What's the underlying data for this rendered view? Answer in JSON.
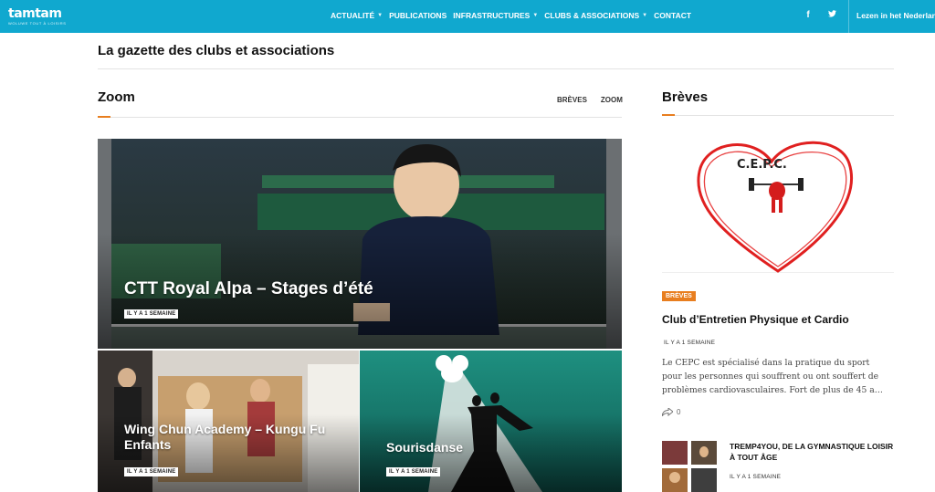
{
  "header": {
    "logo": "tamtam",
    "logo_tagline": "WOLUWE TOUT À LOISIRS",
    "nav": [
      {
        "label": "Actualité",
        "dropdown": true
      },
      {
        "label": "Publications",
        "dropdown": false
      },
      {
        "label": "Infrastructures",
        "dropdown": true
      },
      {
        "label": "Clubs & Associations",
        "dropdown": true
      },
      {
        "label": "Contact",
        "dropdown": false
      }
    ],
    "social": {
      "facebook": "f",
      "twitter": "t"
    },
    "language_link": "Lezen in het Nederlands",
    "bar_color": "#10a8cf"
  },
  "page_title": "La gazette des clubs et associations",
  "zoom_section": {
    "title": "Zoom",
    "tabs": [
      "BRÈVES",
      "ZOOM"
    ],
    "accent_color": "#e87e1f",
    "featured": {
      "title": "CTT Royal Alpa – Stages d’été",
      "time": "IL Y A 1 SEMAINE"
    },
    "cards": [
      {
        "title": "Wing Chun Academy – Kungu Fu Enfants",
        "time": "IL Y A 1 SEMAINE"
      },
      {
        "title": "Sourisdanse",
        "time": "IL Y A 1 SEMAINE"
      }
    ]
  },
  "breves_section": {
    "title": "Brèves",
    "logo_text": "C.E.P.C.",
    "category": "BRÈVES",
    "post_title": "Club d’Entretien Physique et Cardio",
    "time": "IL Y A 1 SEMAINE",
    "excerpt": "Le CEPC est spécialisé dans la pratique du sport pour les personnes qui souffrent ou ont souffert de problèmes cardiovasculaires. Fort de plus de 45 a…",
    "shares": "0",
    "second_post": {
      "title": "TREMP4YOU, de la gymnastique loisir à tout âge",
      "time": "IL Y A 1 SEMAINE"
    }
  }
}
